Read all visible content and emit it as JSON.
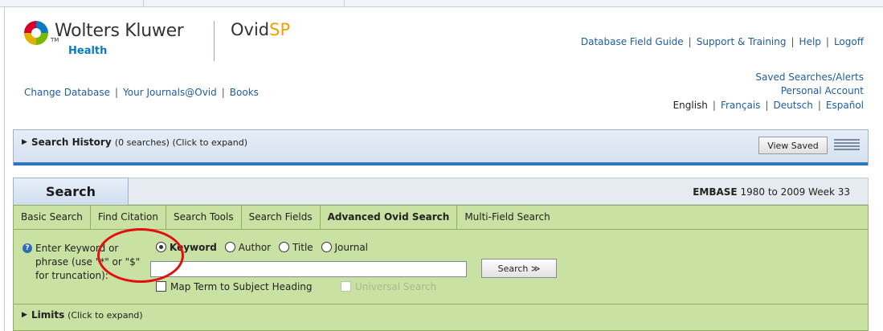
{
  "header": {
    "brand": "Wolters Kluwer",
    "brand_mark": "TM",
    "brand_sub": "Health",
    "product_main": "Ovid",
    "product_accent": "SP",
    "top_nav": [
      "Database Field Guide",
      "Support & Training",
      "Help",
      "Logoff"
    ],
    "sub_nav": [
      "Change Database",
      "Your Journals@Ovid",
      "Books"
    ],
    "right_links": [
      "Saved Searches/Alerts",
      "Personal Account"
    ],
    "languages": [
      "English",
      "Français",
      "Deutsch",
      "Español"
    ]
  },
  "history": {
    "title": "Search History",
    "subtitle": "(0 searches) (Click to expand)",
    "view_saved": "View Saved"
  },
  "search": {
    "tab_label": "Search",
    "database_name": "EMBASE",
    "database_range": "1980 to 2009 Week 33",
    "tabs": [
      "Basic Search",
      "Find Citation",
      "Search Tools",
      "Search Fields",
      "Advanced Ovid Search",
      "Multi-Field Search"
    ],
    "active_tab": "Advanced Ovid Search",
    "keyword_label": "Enter Keyword or phrase (use \"*\" or \"$\" for truncation):",
    "radio_options": [
      "Keyword",
      "Author",
      "Title",
      "Journal"
    ],
    "selected_radio": "Keyword",
    "input_value": "",
    "search_button": "Search ≫",
    "map_term_label": "Map Term to Subject Heading",
    "universal_search_label": "Universal Search",
    "limits_title": "Limits",
    "limits_subtitle": "(Click to expand)"
  },
  "annotation": {
    "color": "#e01010"
  }
}
